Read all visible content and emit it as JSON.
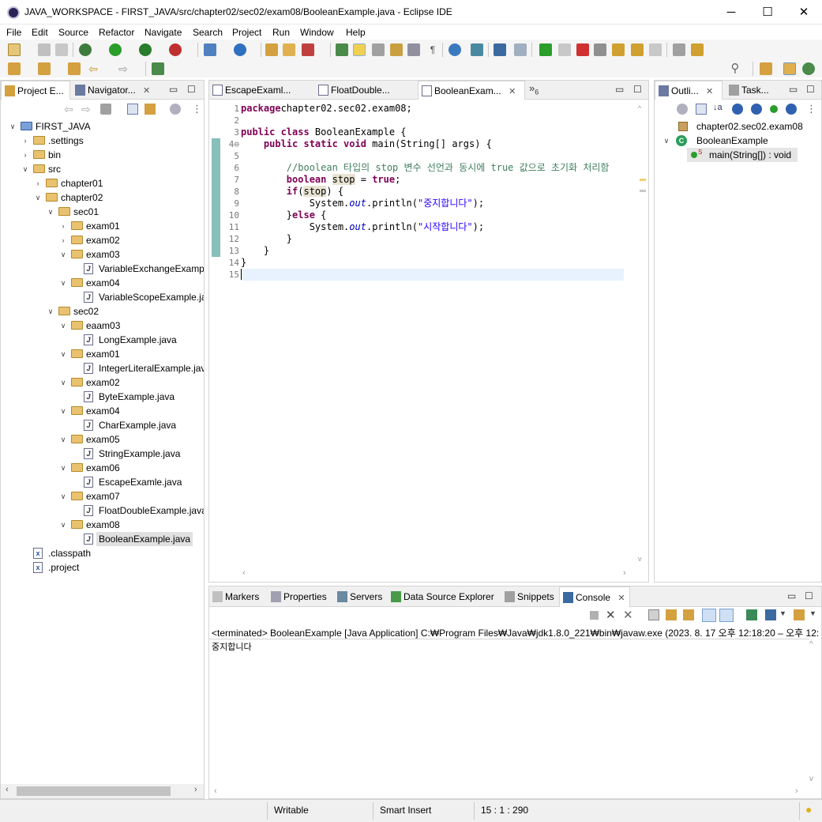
{
  "window": {
    "title": "JAVA_WORKSPACE - FIRST_JAVA/src/chapter02/sec02/exam08/BooleanExample.java - Eclipse IDE",
    "minimize": "─",
    "maximize": "☐",
    "close": "✕"
  },
  "menu": [
    "File",
    "Edit",
    "Source",
    "Refactor",
    "Navigate",
    "Search",
    "Project",
    "Run",
    "Window",
    "Help"
  ],
  "left_panel": {
    "tabs": [
      {
        "label": "Project E..."
      },
      {
        "label": "Navigator..."
      }
    ],
    "close": "✕",
    "tree": [
      {
        "label": "FIRST_JAVA",
        "indent": 0,
        "twisty": "open",
        "icon": "project"
      },
      {
        "label": ".settings",
        "indent": 1,
        "twisty": "closed",
        "icon": "folder"
      },
      {
        "label": "bin",
        "indent": 1,
        "twisty": "closed",
        "icon": "folder"
      },
      {
        "label": "src",
        "indent": 1,
        "twisty": "open",
        "icon": "folder"
      },
      {
        "label": "chapter01",
        "indent": 2,
        "twisty": "closed",
        "icon": "folder"
      },
      {
        "label": "chapter02",
        "indent": 2,
        "twisty": "open",
        "icon": "folder"
      },
      {
        "label": "sec01",
        "indent": 3,
        "twisty": "open",
        "icon": "folder"
      },
      {
        "label": "exam01",
        "indent": 4,
        "twisty": "closed",
        "icon": "folder"
      },
      {
        "label": "exam02",
        "indent": 4,
        "twisty": "closed",
        "icon": "folder"
      },
      {
        "label": "exam03",
        "indent": 4,
        "twisty": "open",
        "icon": "folder"
      },
      {
        "label": "VariableExchangeExampl",
        "indent": 5,
        "twisty": "",
        "icon": "java"
      },
      {
        "label": "exam04",
        "indent": 4,
        "twisty": "open",
        "icon": "folder"
      },
      {
        "label": "VariableScopeExample.ja",
        "indent": 5,
        "twisty": "",
        "icon": "java"
      },
      {
        "label": "sec02",
        "indent": 3,
        "twisty": "open",
        "icon": "folder"
      },
      {
        "label": "eaam03",
        "indent": 4,
        "twisty": "open",
        "icon": "folder"
      },
      {
        "label": "LongExample.java",
        "indent": 5,
        "twisty": "",
        "icon": "java"
      },
      {
        "label": "exam01",
        "indent": 4,
        "twisty": "open",
        "icon": "folder"
      },
      {
        "label": "IntegerLiteralExample.java",
        "indent": 5,
        "twisty": "",
        "icon": "java"
      },
      {
        "label": "exam02",
        "indent": 4,
        "twisty": "open",
        "icon": "folder"
      },
      {
        "label": "ByteExample.java",
        "indent": 5,
        "twisty": "",
        "icon": "java"
      },
      {
        "label": "exam04",
        "indent": 4,
        "twisty": "open",
        "icon": "folder"
      },
      {
        "label": "CharExample.java",
        "indent": 5,
        "twisty": "",
        "icon": "java"
      },
      {
        "label": "exam05",
        "indent": 4,
        "twisty": "open",
        "icon": "folder"
      },
      {
        "label": "StringExample.java",
        "indent": 5,
        "twisty": "",
        "icon": "java"
      },
      {
        "label": "exam06",
        "indent": 4,
        "twisty": "open",
        "icon": "folder"
      },
      {
        "label": "EscapeExamle.java",
        "indent": 5,
        "twisty": "",
        "icon": "java"
      },
      {
        "label": "exam07",
        "indent": 4,
        "twisty": "open",
        "icon": "folder"
      },
      {
        "label": "FloatDoubleExample.java",
        "indent": 5,
        "twisty": "",
        "icon": "java"
      },
      {
        "label": "exam08",
        "indent": 4,
        "twisty": "open",
        "icon": "folder"
      },
      {
        "label": "BooleanExample.java",
        "indent": 5,
        "twisty": "",
        "icon": "java",
        "selected": true
      },
      {
        "label": ".classpath",
        "indent": 1,
        "twisty": "",
        "icon": "xml"
      },
      {
        "label": ".project",
        "indent": 1,
        "twisty": "",
        "icon": "xml"
      }
    ]
  },
  "editor": {
    "tabs": [
      {
        "label": "EscapeExaml..."
      },
      {
        "label": "FloatDouble..."
      },
      {
        "label": "BooleanExam...",
        "active": true
      }
    ],
    "overflow": "»",
    "overflow_count": "6",
    "lines": [
      {
        "n": "1",
        "parts": [
          [
            "kw",
            "package"
          ],
          [
            "",
            "chapter02.sec02.exam08;"
          ]
        ]
      },
      {
        "n": "2",
        "parts": []
      },
      {
        "n": "3",
        "parts": [
          [
            "kw",
            "public class"
          ],
          [
            "",
            " BooleanExample {"
          ]
        ]
      },
      {
        "n": "4⊖",
        "parts": [
          [
            "",
            "    "
          ],
          [
            "kw",
            "public static void"
          ],
          [
            "",
            " main(String[] args) {"
          ]
        ]
      },
      {
        "n": "5",
        "parts": []
      },
      {
        "n": "6",
        "parts": [
          [
            "",
            "        "
          ],
          [
            "cm",
            "//boolean 타입의 stop 변수 선언과 동시에 true 값으로 초기화 처리함"
          ]
        ]
      },
      {
        "n": "7",
        "parts": [
          [
            "",
            "        "
          ],
          [
            "kw",
            "boolean"
          ],
          [
            "",
            " "
          ],
          [
            "hl",
            "stop"
          ],
          [
            "",
            " = "
          ],
          [
            "kw",
            "true"
          ],
          [
            "",
            ";"
          ]
        ]
      },
      {
        "n": "8",
        "parts": [
          [
            "",
            "        "
          ],
          [
            "kw",
            "if"
          ],
          [
            "",
            "("
          ],
          [
            "hl",
            "stop"
          ],
          [
            "",
            ") {"
          ]
        ]
      },
      {
        "n": "9",
        "parts": [
          [
            "",
            "            System."
          ],
          [
            "fld",
            "out"
          ],
          [
            "",
            ".println("
          ],
          [
            "str",
            "\"중지합니다\""
          ],
          [
            "",
            ");"
          ]
        ]
      },
      {
        "n": "10",
        "parts": [
          [
            "",
            "        }"
          ],
          [
            "kw",
            "else"
          ],
          [
            "",
            " {"
          ]
        ]
      },
      {
        "n": "11",
        "parts": [
          [
            "",
            "            System."
          ],
          [
            "fld",
            "out"
          ],
          [
            "",
            ".println("
          ],
          [
            "str",
            "\"시작합니다\""
          ],
          [
            "",
            ");"
          ]
        ]
      },
      {
        "n": "12",
        "parts": [
          [
            "",
            "        }"
          ]
        ]
      },
      {
        "n": "13",
        "parts": [
          [
            "",
            "    }"
          ]
        ]
      },
      {
        "n": "14",
        "parts": [
          [
            "",
            "}"
          ]
        ]
      },
      {
        "n": "15",
        "parts": []
      }
    ]
  },
  "outline": {
    "tabs": [
      {
        "label": "Outli..."
      },
      {
        "label": "Task..."
      }
    ],
    "items": [
      {
        "label": "chapter02.sec02.exam08",
        "icon": "package"
      },
      {
        "label": "BooleanExample",
        "icon": "class"
      },
      {
        "label": "main(String[]) : void",
        "icon": "method",
        "selected": true
      }
    ]
  },
  "bottom_panel": {
    "tabs": [
      {
        "label": "Markers"
      },
      {
        "label": "Properties"
      },
      {
        "label": "Servers"
      },
      {
        "label": "Data Source Explorer"
      },
      {
        "label": "Snippets"
      },
      {
        "label": "Console",
        "active": true
      }
    ],
    "console_header": "<terminated> BooleanExample [Java Application] C:₩Program Files₩Java₩jdk1.8.0_221₩bin₩javaw.exe  (2023. 8. 17 오후 12:18:20 – 오후 12:",
    "console_output": "중지합니다"
  },
  "statusbar": {
    "writable": "Writable",
    "insert_mode": "Smart Insert",
    "position": "15 : 1 : 290"
  },
  "colors": {
    "keyword": "#7f0055",
    "comment": "#3f7f5f",
    "string": "#2a00ff",
    "field": "#0000c0"
  }
}
